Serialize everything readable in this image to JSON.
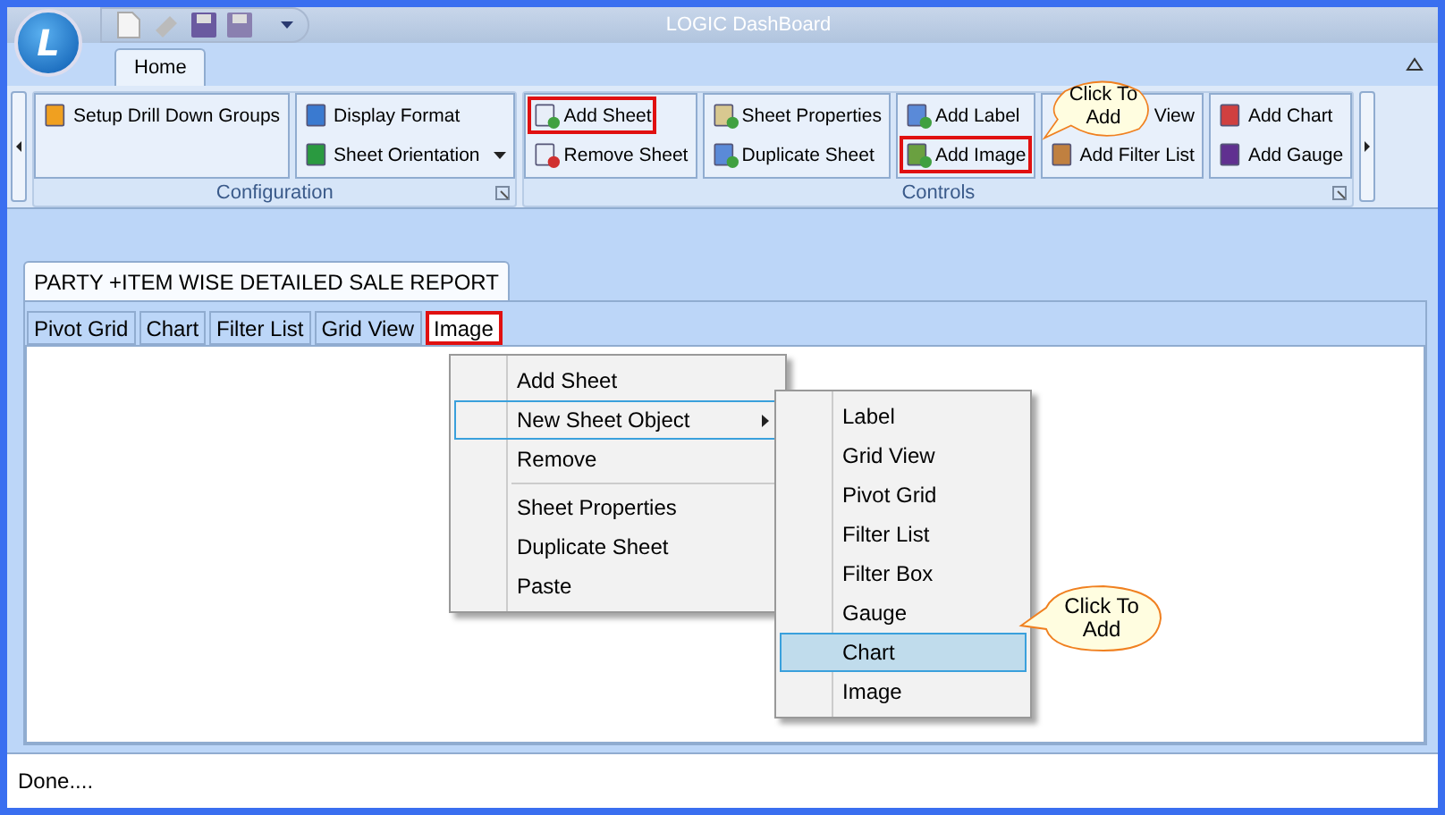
{
  "window": {
    "title": "LOGIC DashBoard",
    "logo": "L"
  },
  "ribbon": {
    "tabs": [
      {
        "label": "Home",
        "selected": true
      }
    ],
    "groups": [
      {
        "name": "Configuration",
        "columns": [
          [
            {
              "label": "Setup Drill Down Groups",
              "highlighted": false
            }
          ],
          [
            {
              "label": "Display Format",
              "highlighted": false
            },
            {
              "label": "Sheet Orientation",
              "highlighted": false
            }
          ]
        ]
      },
      {
        "name": "Controls",
        "columns": [
          [
            {
              "label": "Add Sheet",
              "highlighted": true
            },
            {
              "label": "Remove Sheet",
              "highlighted": false
            }
          ],
          [
            {
              "label": "Sheet Properties",
              "highlighted": false
            },
            {
              "label": "Duplicate Sheet",
              "highlighted": false
            }
          ],
          [
            {
              "label": "Add Label",
              "highlighted": false
            },
            {
              "label": "Add Image",
              "highlighted": true
            }
          ],
          [
            {
              "label": "View",
              "highlighted": false
            },
            {
              "label": "Add Filter List",
              "highlighted": false
            }
          ],
          [
            {
              "label": "Add Chart",
              "highlighted": false
            },
            {
              "label": "Add Gauge",
              "highlighted": false
            }
          ]
        ]
      }
    ]
  },
  "callouts": [
    {
      "text": "Click To Add"
    },
    {
      "text": "Click To Add"
    }
  ],
  "report_tab": {
    "label": "PARTY +ITEM WISE DETAILED SALE REPORT"
  },
  "sheet_tabs": [
    {
      "label": "Pivot Grid",
      "highlighted": false
    },
    {
      "label": "Chart",
      "highlighted": false
    },
    {
      "label": "Filter List",
      "highlighted": false
    },
    {
      "label": "Grid View",
      "highlighted": false
    },
    {
      "label": "Image",
      "highlighted": true
    }
  ],
  "context_menu": [
    {
      "items": [
        {
          "label": "Add Sheet",
          "kind": "command",
          "selected": false
        },
        {
          "label": "New Sheet Object",
          "kind": "submenu",
          "selected": true
        },
        {
          "label": "Remove",
          "kind": "command",
          "selected": false
        }
      ]
    },
    {
      "items": [
        {
          "label": "Sheet Properties",
          "kind": "command",
          "selected": false
        },
        {
          "label": "Duplicate Sheet",
          "kind": "command",
          "selected": false
        },
        {
          "label": "Paste",
          "kind": "command",
          "selected": false
        }
      ]
    }
  ],
  "submenu": [
    {
      "label": "Label",
      "selected": false
    },
    {
      "label": "Grid View",
      "selected": false
    },
    {
      "label": "Pivot Grid",
      "selected": false
    },
    {
      "label": "Filter List",
      "selected": false
    },
    {
      "label": "Filter Box",
      "selected": false
    },
    {
      "label": "Gauge",
      "selected": false
    },
    {
      "label": "Chart",
      "selected": true
    },
    {
      "label": "Image",
      "selected": false
    }
  ],
  "status_bar": "Done...."
}
